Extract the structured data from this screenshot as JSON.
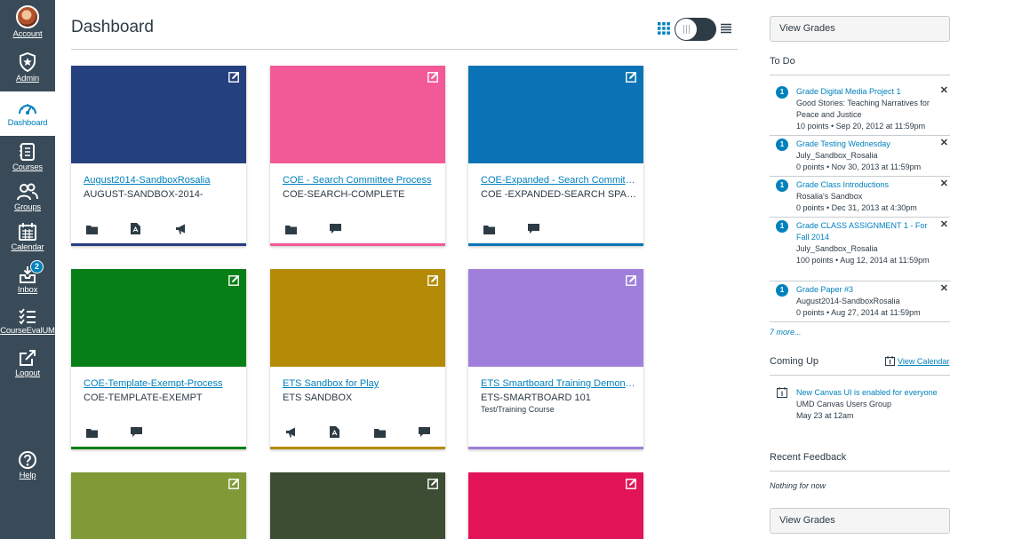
{
  "nav": {
    "account": "Account",
    "admin": "Admin",
    "dashboard": "Dashboard",
    "courses": "Courses",
    "groups": "Groups",
    "calendar": "Calendar",
    "inbox": "Inbox",
    "inbox_count": "2",
    "courseeval": "CourseEvalUM",
    "logout": "Logout",
    "help": "Help"
  },
  "header": {
    "title": "Dashboard",
    "view_mode": "card"
  },
  "cards": [
    {
      "title": "August2014-SandboxRosalia",
      "code": "AUGUST-SANDBOX-2014-",
      "term": "",
      "color": "#25407f",
      "icons": [
        "folder-icon",
        "files-icon",
        "announcement-icon"
      ]
    },
    {
      "title": "COE - Search Committee Process",
      "code": "COE-SEARCH-COMPLETE",
      "term": "",
      "color": "#f25a97",
      "icons": [
        "folder-icon",
        "discussion-icon"
      ]
    },
    {
      "title": "COE-Expanded - Search Committee Process",
      "code": "COE -EXPANDED-SEARCH SPACE",
      "term": "",
      "color": "#0b73b5",
      "icons": [
        "folder-icon",
        "discussion-icon"
      ]
    },
    {
      "title": "COE-Template-Exempt-Process",
      "code": "COE-TEMPLATE-EXEMPT",
      "term": "",
      "color": "#067f16",
      "icons": [
        "folder-icon",
        "discussion-icon"
      ]
    },
    {
      "title": "ETS Sandbox for Play",
      "code": "ETS SANDBOX",
      "term": "",
      "color": "#b48b06",
      "icons": [
        "announcement-icon",
        "files-icon",
        "folder-icon",
        "discussion-icon"
      ]
    },
    {
      "title": "ETS Smartboard Training Demonstration",
      "code": "ETS-SMARTBOARD 101",
      "term": "Test/Training Course",
      "color": "#9f7fdb",
      "icons": []
    },
    {
      "title": "",
      "code": "",
      "term": "",
      "color": "#7f9a36",
      "icons": []
    },
    {
      "title": "",
      "code": "",
      "term": "",
      "color": "#3d4d33",
      "icons": []
    },
    {
      "title": "",
      "code": "",
      "term": "",
      "color": "#e21457",
      "icons": []
    }
  ],
  "sidebar": {
    "view_grades": "View Grades",
    "todo_heading": "To Do",
    "todos": [
      {
        "count": "1",
        "title": "Grade Digital Media Project 1",
        "course": "Good Stories: Teaching Narratives for Peace and Justice",
        "meta": "10 points • Sep 20, 2012 at 11:59pm"
      },
      {
        "count": "1",
        "title": "Grade Testing Wednesday",
        "course": "July_Sandbox_Rosalia",
        "meta": "0 points • Nov 30, 2013 at 11:59pm"
      },
      {
        "count": "1",
        "title": "Grade Class Introductions",
        "course": "Rosalia's Sandbox",
        "meta": "0 points • Dec 31, 2013 at 4:30pm"
      },
      {
        "count": "1",
        "title": "Grade CLASS ASSIGNMENT 1 - For Fall 2014",
        "course": "July_Sandbox_Rosalia",
        "meta": "100 points • Aug 12, 2014 at 11:59pm"
      },
      {
        "count": "1",
        "title": "Grade Paper #3",
        "course": "August2014-SandboxRosalia",
        "meta": "0 points • Aug 27, 2014 at 11:59pm"
      }
    ],
    "more": "7 more...",
    "coming_up": "Coming Up",
    "view_calendar": "View Calendar",
    "event": {
      "title": "New Canvas UI is enabled for everyone",
      "group": "UMD Canvas Users Group",
      "when": "May 23 at 12am"
    },
    "recent_feedback": "Recent Feedback",
    "nothing": "Nothing for now",
    "view_grades_bottom": "View Grades"
  }
}
